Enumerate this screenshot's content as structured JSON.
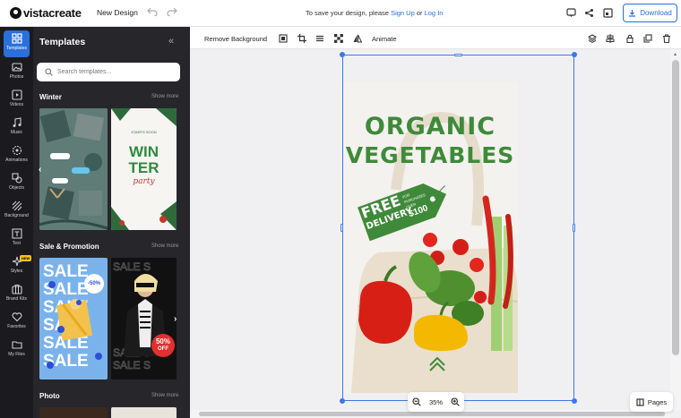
{
  "header": {
    "logo_text": "vistacreate",
    "new_design": "New Design",
    "save_prefix": "To save your design, please ",
    "sign_up": "Sign Up",
    "or": " or ",
    "log_in": "Log In",
    "download": "Download"
  },
  "rail": {
    "items": [
      {
        "label": "Templates",
        "icon": "templates-icon"
      },
      {
        "label": "Photos",
        "icon": "photos-icon"
      },
      {
        "label": "Videos",
        "icon": "videos-icon"
      },
      {
        "label": "Music",
        "icon": "music-icon"
      },
      {
        "label": "Animations",
        "icon": "animations-icon"
      },
      {
        "label": "Objects",
        "icon": "objects-icon"
      },
      {
        "label": "Background",
        "icon": "background-icon"
      },
      {
        "label": "Text",
        "icon": "text-icon"
      },
      {
        "label": "Styles",
        "icon": "styles-icon"
      },
      {
        "label": "Brand Kits",
        "icon": "brand-kits-icon"
      },
      {
        "label": "Favorites",
        "icon": "favorites-icon"
      },
      {
        "label": "My Files",
        "icon": "my-files-icon"
      }
    ],
    "new_badge": "NEW"
  },
  "panel": {
    "title": "Templates",
    "search_placeholder": "Search templates...",
    "sections": [
      {
        "title": "Winter",
        "show_more": "Show more"
      },
      {
        "title": "Sale & Promotion",
        "show_more": "Show more"
      },
      {
        "title": "Photo",
        "show_more": "Show more"
      }
    ],
    "winter_thumb": {
      "line1": "WIN",
      "line2": "TER",
      "script": "party",
      "top_small": "STARTS SOON"
    },
    "sale_thumb": {
      "word": "SALE",
      "badge": "-50%"
    },
    "sale_thumb2": {
      "badge_pct": "50%",
      "badge_off": "OFF"
    }
  },
  "toolbar": {
    "remove_background": "Remove Background",
    "animate": "Animate"
  },
  "canvas": {
    "heading1": "ORGANIC",
    "heading2": "VEGETABLES",
    "tag_main1": "FREE",
    "tag_main2": "DELIVERY",
    "tag_small1": "FOR",
    "tag_small2": "PURCHASES",
    "tag_small3": "OVER",
    "tag_amount": "$100"
  },
  "zoom": {
    "level": "35%"
  },
  "pages_label": "Pages",
  "colors": {
    "accent": "#2a6fdb",
    "panel_bg": "#26262b",
    "rail_bg": "#1b1b1f",
    "organic_green": "#3f8a3a"
  }
}
